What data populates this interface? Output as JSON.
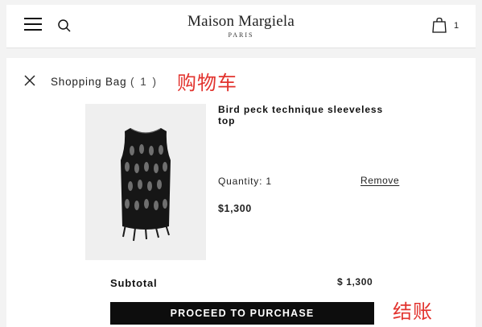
{
  "header": {
    "brand_name": "Maison Margiela",
    "brand_sub": "PARIS",
    "bag_count": "1",
    "icons": [
      "menu-icon",
      "search-icon",
      "shopping-bag-icon"
    ]
  },
  "bag": {
    "title": "Shopping Bag",
    "count_text": "( 1 )",
    "annotation_cart": "购物车",
    "annotation_checkout": "结账"
  },
  "item": {
    "name": "Bird peck technique sleeveless top",
    "quantity_label": "Quantity: 1",
    "remove_label": "Remove",
    "price": "$1,300"
  },
  "summary": {
    "subtotal_label": "Subtotal",
    "subtotal_value": "$ 1,300",
    "purchase_label": "PROCEED TO PURCHASE"
  },
  "colors": {
    "background": "#f3f3f3",
    "panel": "#ffffff",
    "button": "#0d0d0d",
    "annotation": "#e2332e"
  }
}
